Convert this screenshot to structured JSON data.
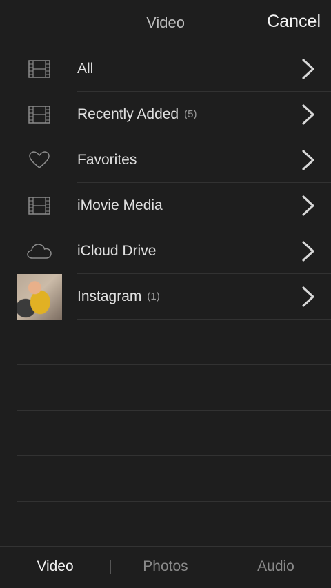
{
  "header": {
    "title": "Video",
    "cancel_label": "Cancel"
  },
  "rows": [
    {
      "label": "All",
      "count": "",
      "icon": "film-icon"
    },
    {
      "label": "Recently Added",
      "count": "(5)",
      "icon": "film-icon"
    },
    {
      "label": "Favorites",
      "count": "",
      "icon": "heart-icon"
    },
    {
      "label": "iMovie Media",
      "count": "",
      "icon": "film-icon"
    },
    {
      "label": "iCloud Drive",
      "count": "",
      "icon": "cloud-icon"
    },
    {
      "label": "Instagram",
      "count": "(1)",
      "icon": "album-thumbnail"
    }
  ],
  "tabs": [
    {
      "label": "Video",
      "active": true
    },
    {
      "label": "Photos",
      "active": false
    },
    {
      "label": "Audio",
      "active": false
    }
  ]
}
